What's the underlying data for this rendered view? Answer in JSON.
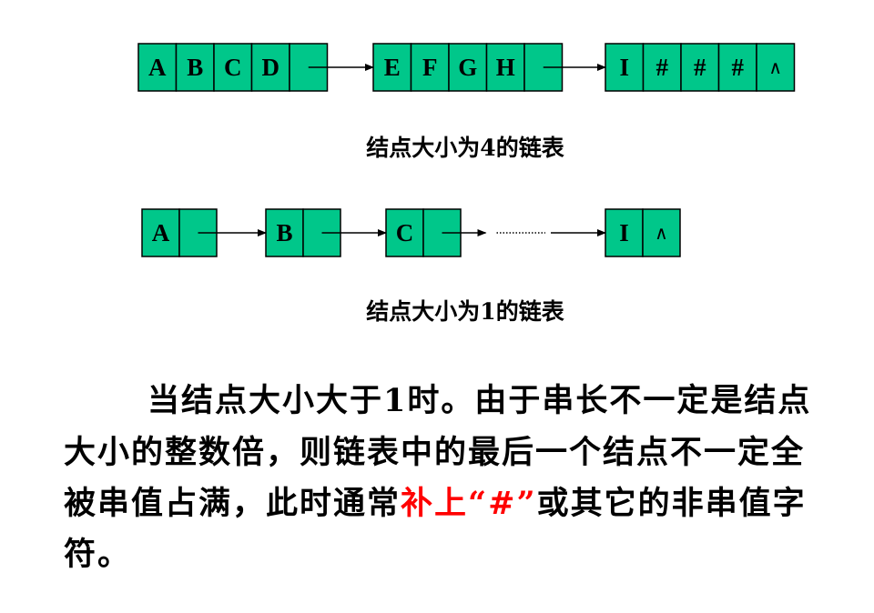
{
  "colors": {
    "node_fill": "#00c78a",
    "border": "#000000",
    "highlight": "#ff0000"
  },
  "diagram": {
    "list4": {
      "nodes": [
        {
          "chars": [
            "A",
            "B",
            "C",
            "D"
          ],
          "next": "link"
        },
        {
          "chars": [
            "E",
            "F",
            "G",
            "H"
          ],
          "next": "link"
        },
        {
          "chars": [
            "I",
            "#",
            "#",
            "#"
          ],
          "next": "∧"
        }
      ],
      "caption": "结点大小为4的链表"
    },
    "list1": {
      "nodes": [
        {
          "chars": [
            "A"
          ],
          "next": "link"
        },
        {
          "chars": [
            "B"
          ],
          "next": "link"
        },
        {
          "chars": [
            "C"
          ],
          "next": "link"
        },
        {
          "chars": [
            "I"
          ],
          "next": "∧"
        }
      ],
      "ellipsis": true,
      "caption": "结点大小为1的链表"
    }
  },
  "paragraph": {
    "line1": "当结点大小大于1时。由于串长不一定是结点",
    "line2": "大小的整数倍，则链表中的最后一个结点不一定全",
    "line3_pre": "被串值占满，此时通常",
    "line3_red": "补上“#”",
    "line3_post": "或其它的非串值字",
    "line4": "符。"
  }
}
